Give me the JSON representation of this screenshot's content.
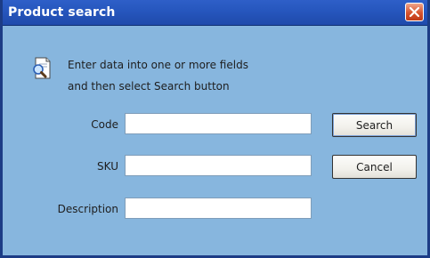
{
  "window": {
    "title": "Product search"
  },
  "icons": {
    "close": "close-icon",
    "info": "search-document-icon"
  },
  "instructions": {
    "line1": "Enter data into one or more fields",
    "line2": "and then select Search button"
  },
  "fields": [
    {
      "label": "Code",
      "value": ""
    },
    {
      "label": "SKU",
      "value": ""
    },
    {
      "label": "Description",
      "value": ""
    }
  ],
  "buttons": {
    "search": "Search",
    "cancel": "Cancel"
  },
  "colors": {
    "titlebar": "#2656bd",
    "background": "#87b6de",
    "close_button": "#d6542f"
  }
}
